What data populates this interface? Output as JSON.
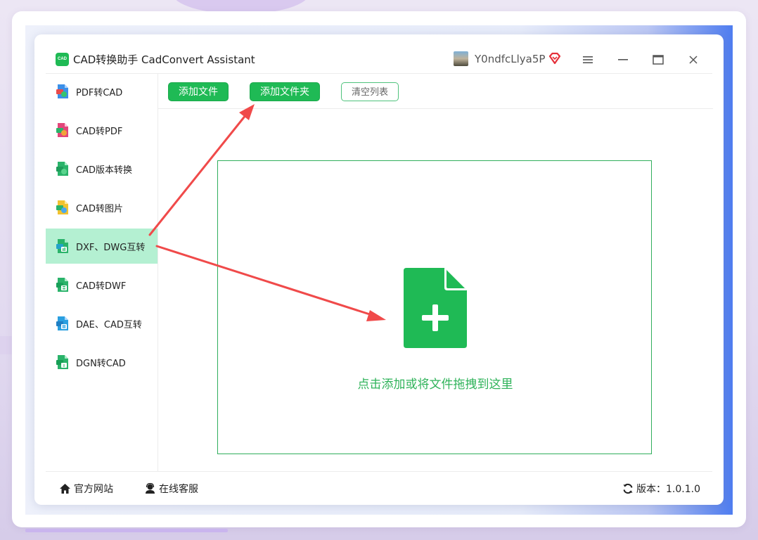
{
  "app": {
    "logo_text": "CAD",
    "title": "CAD转换助手 CadConvert Assistant",
    "username": "Y0ndfcLlya5P"
  },
  "sidebar": {
    "items": [
      {
        "label": "PDF转CAD",
        "icon": "pdf-to-cad-icon",
        "active": false
      },
      {
        "label": "CAD转PDF",
        "icon": "cad-to-pdf-icon",
        "active": false
      },
      {
        "label": "CAD版本转换",
        "icon": "cad-version-convert-icon",
        "active": false
      },
      {
        "label": "CAD转图片",
        "icon": "cad-to-image-icon",
        "active": false
      },
      {
        "label": "DXF、DWG互转",
        "icon": "dxf-dwg-convert-icon",
        "active": true
      },
      {
        "label": "CAD转DWF",
        "icon": "cad-to-dwf-icon",
        "active": false
      },
      {
        "label": "DAE、CAD互转",
        "icon": "dae-cad-convert-icon",
        "active": false
      },
      {
        "label": "DGN转CAD",
        "icon": "dgn-to-cad-icon",
        "active": false
      }
    ]
  },
  "toolbar": {
    "add_file": "添加文件",
    "add_folder": "添加文件夹",
    "clear_list": "清空列表"
  },
  "drop_zone": {
    "hint": "点击添加或将文件拖拽到这里"
  },
  "footer": {
    "website": "官方网站",
    "support": "在线客服",
    "version": "版本：1.0.1.0"
  },
  "colors": {
    "accent_green": "#1fba55",
    "active_item_bg": "#b4f0d2",
    "annotation_arrow": "#f04a4a",
    "vip_red": "#e5303a"
  }
}
